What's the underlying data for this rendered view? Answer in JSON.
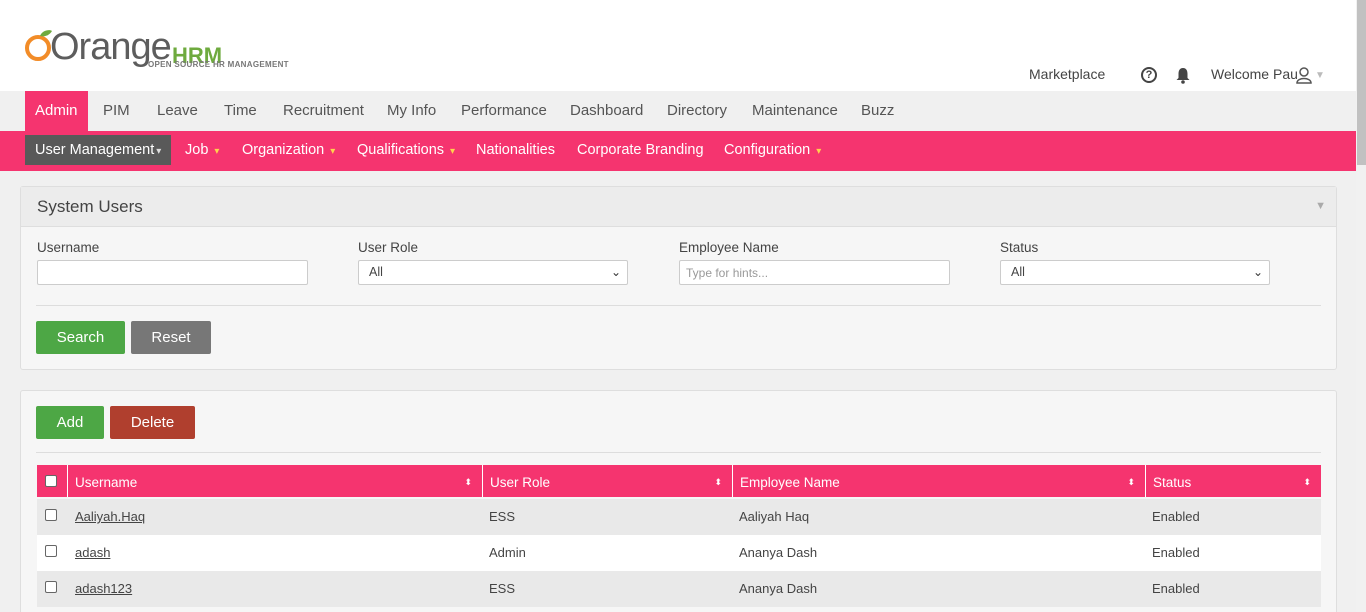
{
  "header": {
    "logo_main": "Orange",
    "logo_hrm": "HRM",
    "logo_sub": "OPEN SOURCE HR MANAGEMENT",
    "marketplace": "Marketplace",
    "welcome": "Welcome Pau"
  },
  "main_nav": [
    "Admin",
    "PIM",
    "Leave",
    "Time",
    "Recruitment",
    "My Info",
    "Performance",
    "Dashboard",
    "Directory",
    "Maintenance",
    "Buzz"
  ],
  "sub_nav": [
    {
      "label": "User Management",
      "arrow": "▾"
    },
    {
      "label": "Job",
      "arrow": "▾"
    },
    {
      "label": "Organization",
      "arrow": "▾"
    },
    {
      "label": "Qualifications",
      "arrow": "▾"
    },
    {
      "label": "Nationalities",
      "arrow": ""
    },
    {
      "label": "Corporate Branding",
      "arrow": ""
    },
    {
      "label": "Configuration",
      "arrow": "▾"
    }
  ],
  "search_panel": {
    "title": "System Users",
    "username_label": "Username",
    "username_value": "",
    "user_role_label": "User Role",
    "user_role_value": "All",
    "employee_name_label": "Employee Name",
    "employee_name_placeholder": "Type for hints...",
    "status_label": "Status",
    "status_value": "All",
    "search_button": "Search",
    "reset_button": "Reset"
  },
  "list_panel": {
    "add_button": "Add",
    "delete_button": "Delete",
    "columns": [
      "Username",
      "User Role",
      "Employee Name",
      "Status"
    ],
    "rows": [
      {
        "username": "Aaliyah.Haq",
        "role": "ESS",
        "employee": "Aaliyah Haq",
        "status": "Enabled"
      },
      {
        "username": "adash",
        "role": "Admin",
        "employee": "Ananya Dash",
        "status": "Enabled"
      },
      {
        "username": "adash123",
        "role": "ESS",
        "employee": "Ananya Dash",
        "status": "Enabled"
      }
    ]
  },
  "colors": {
    "brand_pink": "#f5346f",
    "green": "#4da745",
    "red": "#b03f2e"
  }
}
